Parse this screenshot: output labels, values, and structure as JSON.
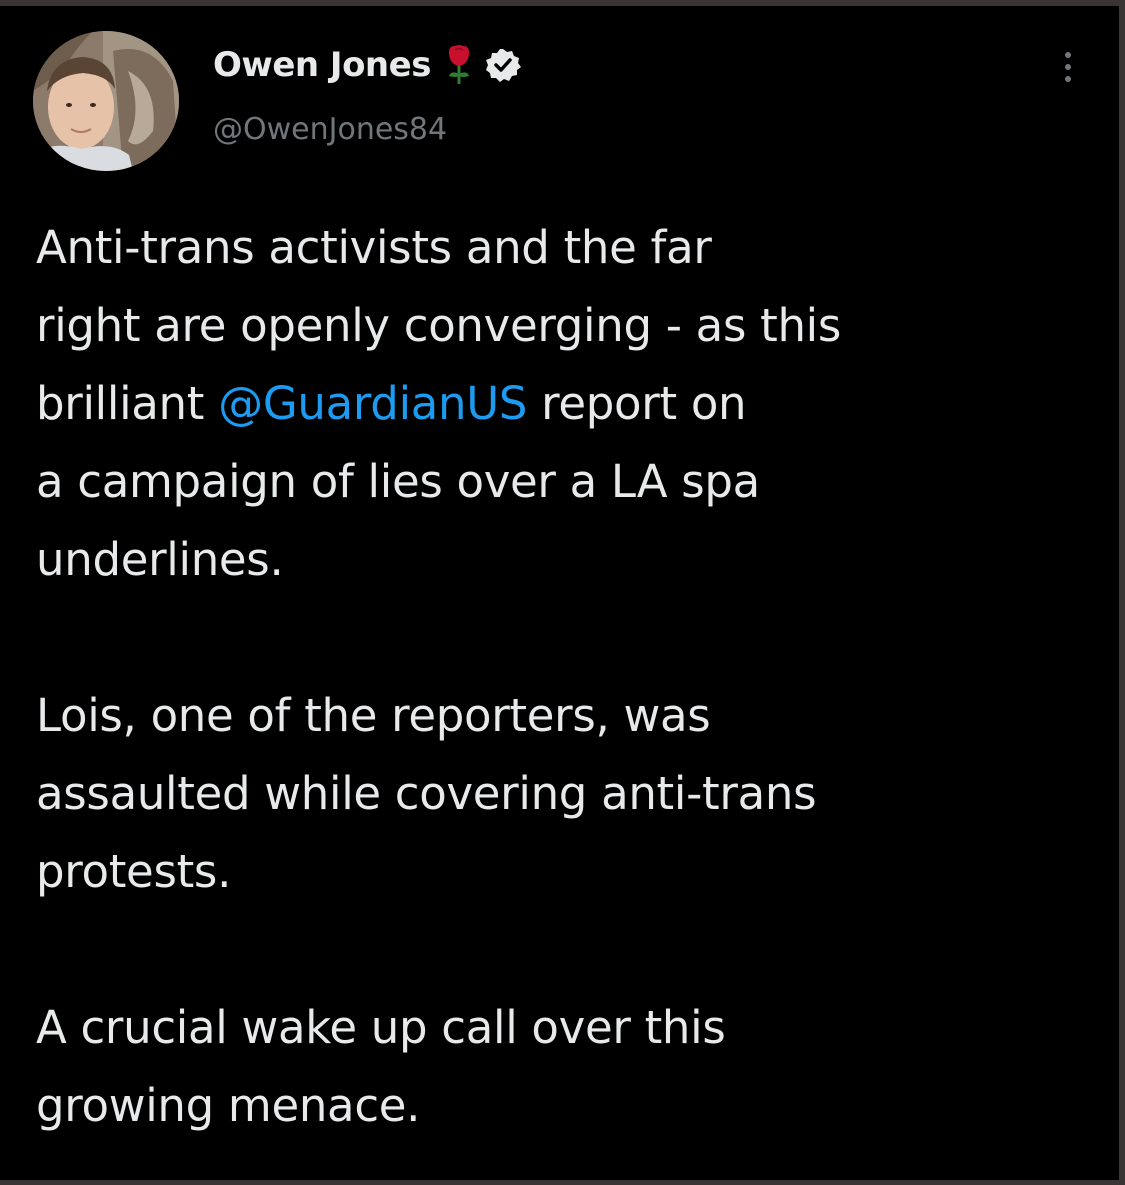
{
  "tweet": {
    "author": {
      "display_name": "Owen Jones",
      "handle": "@OwenJones84",
      "avatar_icon": "profile-photo",
      "emoji_icon": "rose-icon",
      "badge_icon": "verified-badge-icon"
    },
    "menu_icon": "more-options-icon",
    "body": {
      "p1": {
        "line1": "Anti-trans activists and the far",
        "line2": "right are openly converging - as this",
        "line3_pre": "brilliant ",
        "mention": "@GuardianUS",
        "line3_post": " report on",
        "line4": "a campaign of lies over a LA spa",
        "line5": "underlines."
      },
      "p2": {
        "line1": "Lois, one of the reporters, was",
        "line2": "assaulted while covering anti-trans",
        "line3": "protests."
      },
      "p3": {
        "line1": "A crucial wake up call over this",
        "line2": "growing menace."
      }
    },
    "colors": {
      "background": "#000000",
      "text": "#e7e9ea",
      "secondary_text": "#71767b",
      "link": "#1d9bf0",
      "verified_badge": "#e7e9ea",
      "rose": "#c8102e"
    }
  }
}
